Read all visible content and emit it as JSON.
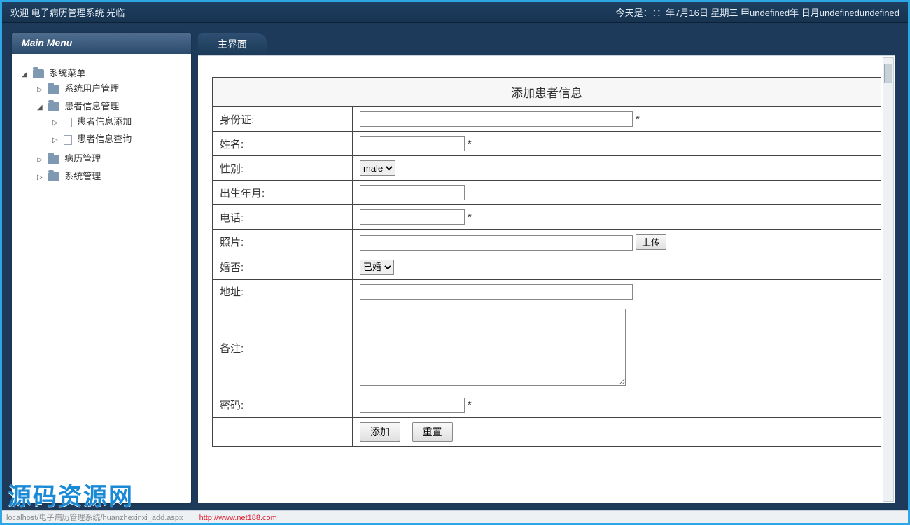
{
  "topbar": {
    "welcome": "欢迎 电子病历管理系统 光临",
    "today_label": "今天是：",
    "today_value": "：：年7月16日  星期三  甲undefined年  日月undefinedundefined"
  },
  "sidebar": {
    "title": "Main Menu",
    "root": {
      "label": "系统菜单",
      "children": [
        {
          "label": "系统用户管理",
          "icon": "folder",
          "toggle": "▷"
        },
        {
          "label": "患者信息管理",
          "icon": "folder",
          "toggle": "◢",
          "children": [
            {
              "label": "患者信息添加",
              "icon": "file",
              "toggle": "▷"
            },
            {
              "label": "患者信息查询",
              "icon": "file",
              "toggle": "▷"
            }
          ]
        },
        {
          "label": "病历管理",
          "icon": "folder",
          "toggle": "▷"
        },
        {
          "label": "系统管理",
          "icon": "folder",
          "toggle": "▷"
        }
      ]
    }
  },
  "main": {
    "tab_label": "主界面",
    "form_title": "添加患者信息",
    "required_mark": "*",
    "fields": {
      "id_label": "身份证:",
      "name_label": "姓名:",
      "gender_label": "性别:",
      "gender_value": "male",
      "birth_label": "出生年月:",
      "phone_label": "电话:",
      "photo_label": "照片:",
      "upload_btn": "上传",
      "marital_label": "婚否:",
      "marital_value": "已婚",
      "address_label": "地址:",
      "remark_label": "备注:",
      "password_label": "密码:"
    },
    "buttons": {
      "submit": "添加",
      "reset": "重置"
    }
  },
  "status": {
    "path": "localhost/电子病历管理系统/huanzhexinxi_add.aspx",
    "wm_url": "http://www.net188.com"
  },
  "watermark": "源码资源网"
}
